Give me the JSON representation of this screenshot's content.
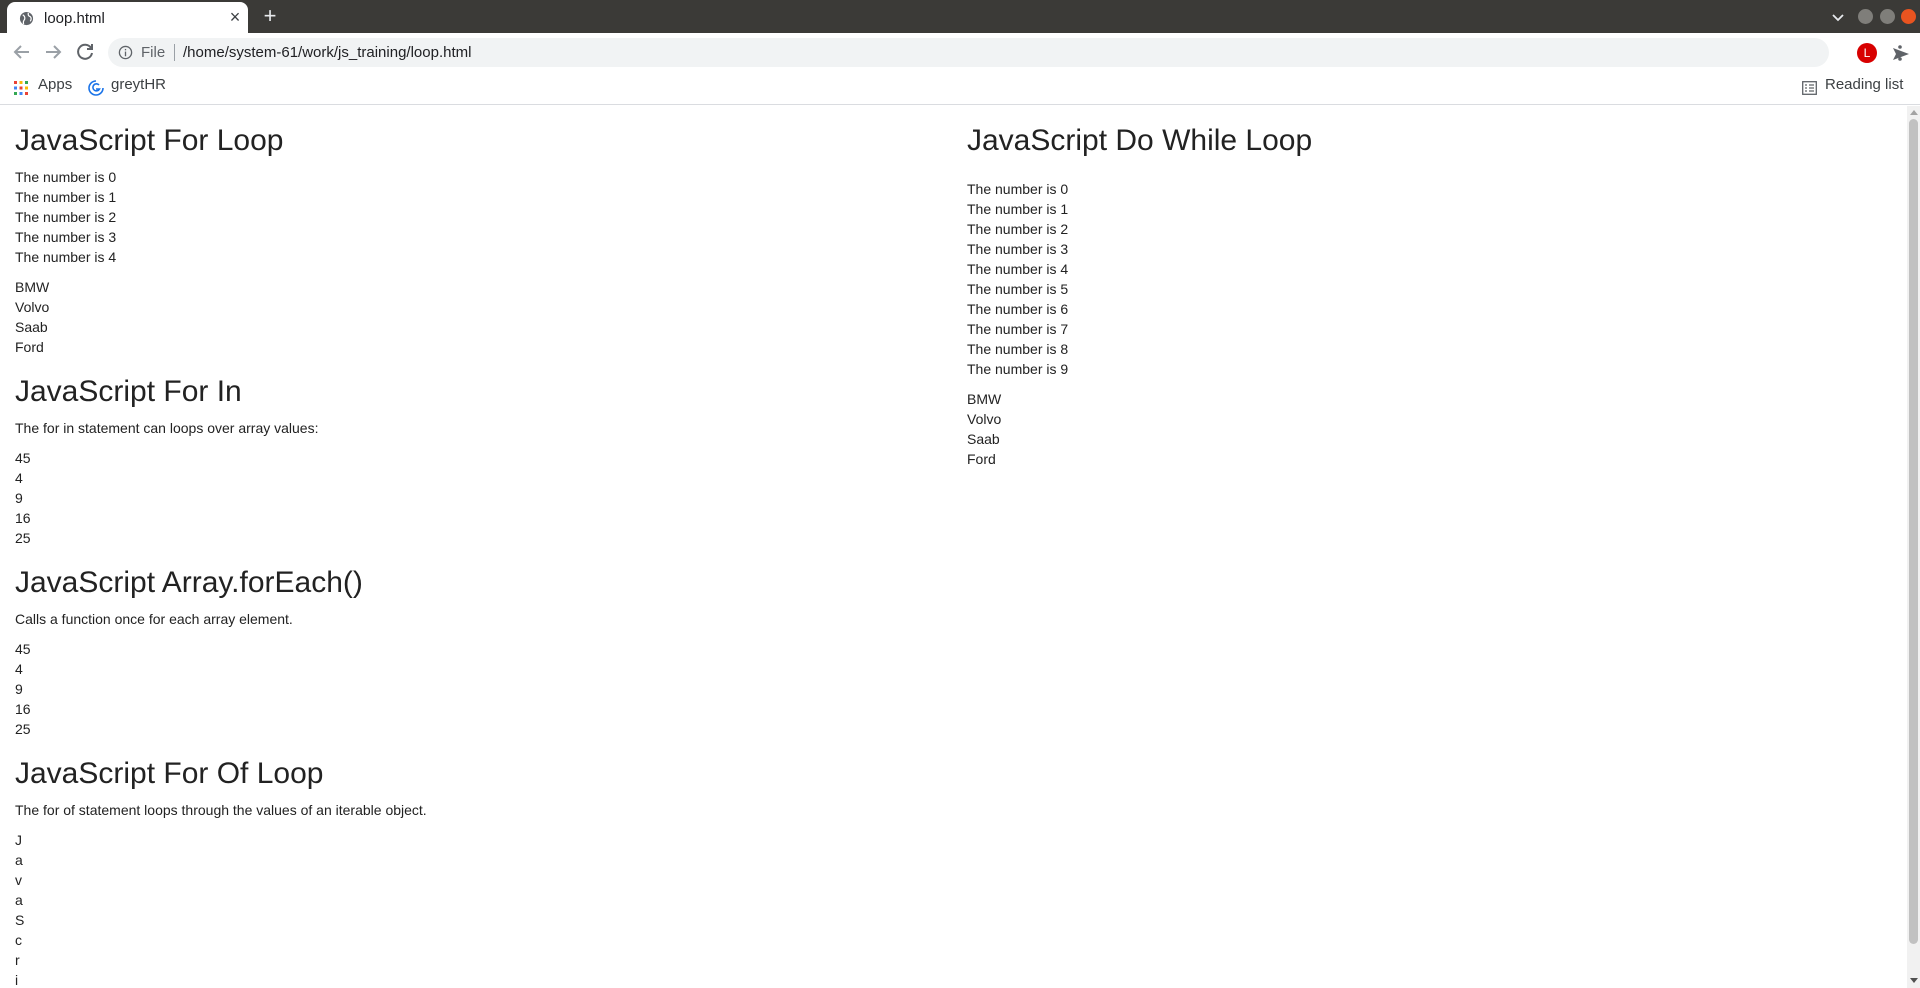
{
  "browser": {
    "tab_title": "loop.html",
    "new_tab_symbol": "+",
    "close_tab_symbol": "×",
    "file_label": "File",
    "url": "/home/system-61/work/js_training/loop.html",
    "profile_initial": "L",
    "icons": [
      "globe-icon",
      "tab-search-icon",
      "back-icon",
      "forward-icon",
      "reload-icon",
      "info-icon",
      "send-icon",
      "star-icon",
      "kebab-menu-icon"
    ],
    "colors": {
      "tab_strip": "#3b3a37",
      "close_window": "#e95420",
      "avatar": "#d80000"
    }
  },
  "bookmarks": {
    "apps_label": "Apps",
    "greythr_label": "greytHR",
    "reading_list_label": "Reading list"
  },
  "left": {
    "for_loop": {
      "heading": "JavaScript For Loop",
      "numbers": [
        "The number is 0",
        "The number is 1",
        "The number is 2",
        "The number is 3",
        "The number is 4"
      ],
      "cars": [
        "BMW",
        "Volvo",
        "Saab",
        "Ford"
      ]
    },
    "for_in": {
      "heading": "JavaScript For In",
      "description": "The for in statement can loops over array values:",
      "values": [
        "45",
        "4",
        "9",
        "16",
        "25"
      ]
    },
    "for_each": {
      "heading": "JavaScript Array.forEach()",
      "description": "Calls a function once for each array element.",
      "values": [
        "45",
        "4",
        "9",
        "16",
        "25"
      ]
    },
    "for_of": {
      "heading": "JavaScript For Of Loop",
      "description": "The for of statement loops through the values of an iterable object.",
      "letters": [
        "J",
        "a",
        "v",
        "a",
        "S",
        "c",
        "r",
        "i"
      ]
    }
  },
  "right": {
    "do_while": {
      "heading": "JavaScript Do While Loop",
      "numbers": [
        "The number is 0",
        "The number is 1",
        "The number is 2",
        "The number is 3",
        "The number is 4",
        "The number is 5",
        "The number is 6",
        "The number is 7",
        "The number is 8",
        "The number is 9"
      ],
      "cars": [
        "BMW",
        "Volvo",
        "Saab",
        "Ford"
      ]
    }
  }
}
